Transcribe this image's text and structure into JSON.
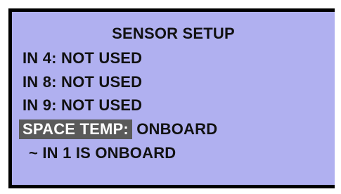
{
  "screen": {
    "title": "SENSOR SETUP",
    "rows": [
      {
        "label": "IN 4:",
        "value": "NOT USED"
      },
      {
        "label": "IN 8:",
        "value": "NOT USED"
      },
      {
        "label": "IN 9:",
        "value": "NOT USED"
      }
    ],
    "selected_row": {
      "label": "SPACE TEMP:",
      "value": "ONBOARD"
    },
    "note": "~ IN 1 IS ONBOARD",
    "colors": {
      "bezel": "#000000",
      "lcd_background": "#b0b0f0",
      "text": "#111111",
      "highlight_background": "#5a5a5a",
      "highlight_text": "#ffffff"
    }
  }
}
